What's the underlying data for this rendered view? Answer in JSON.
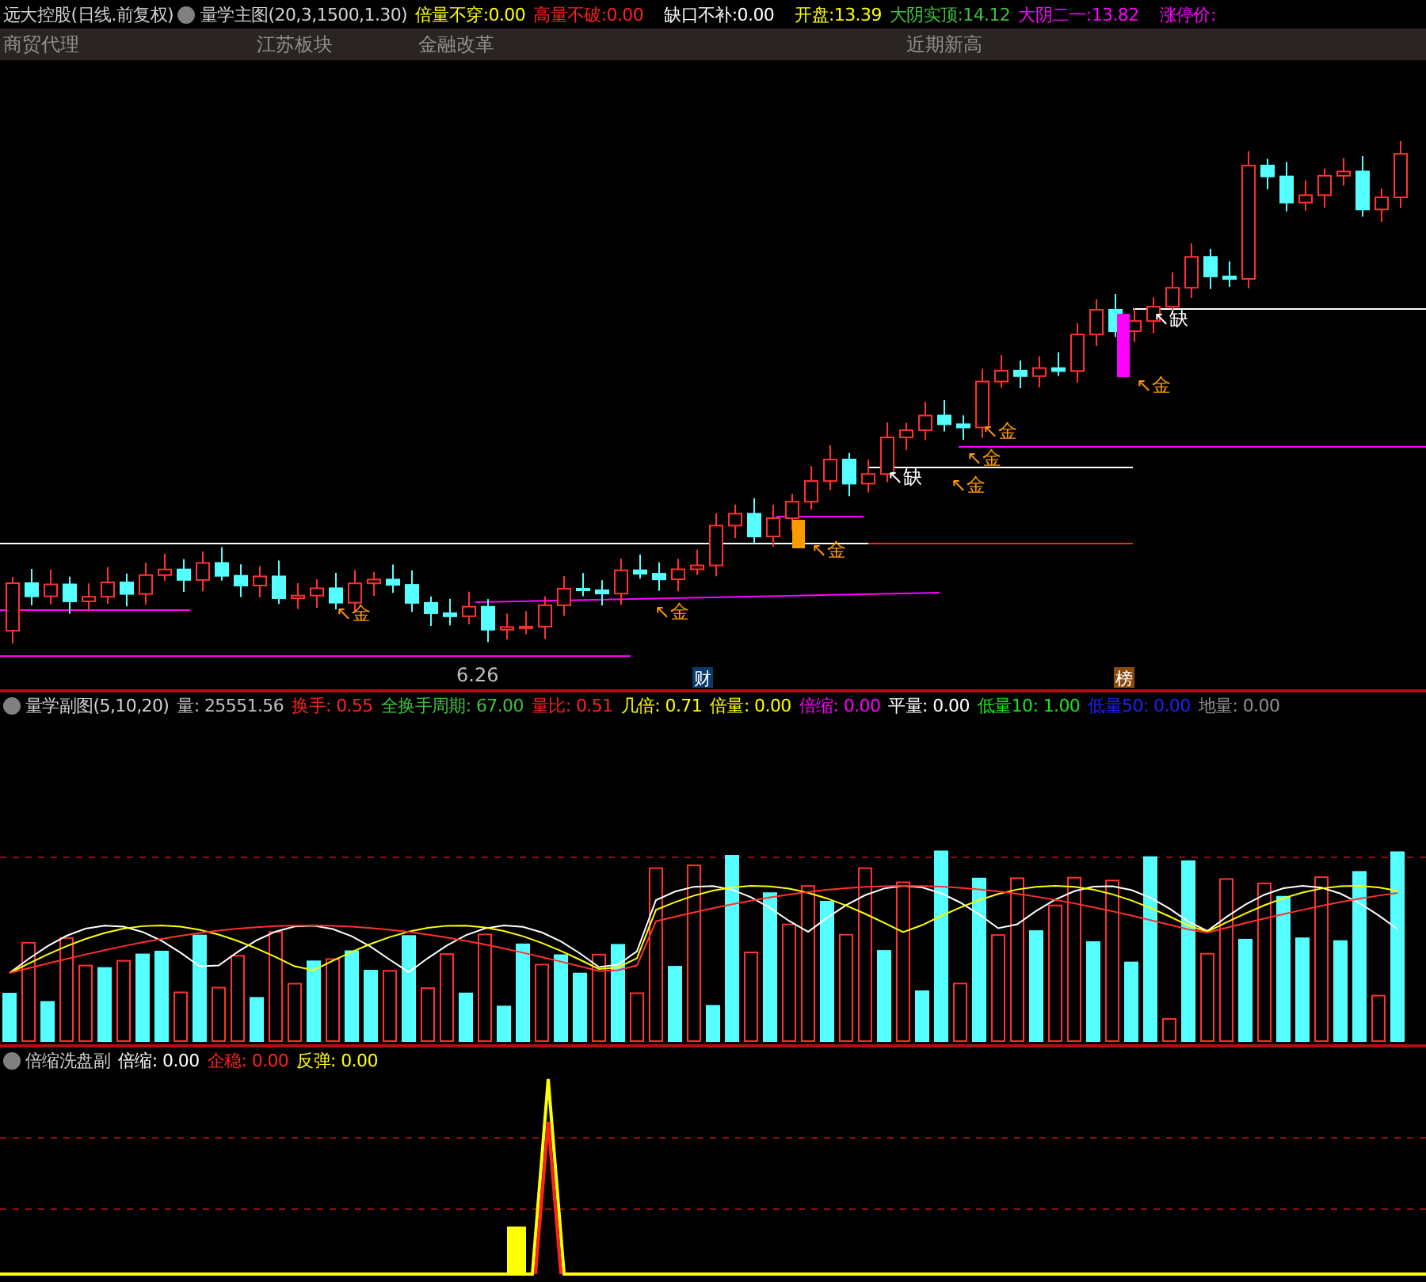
{
  "main_header": {
    "title": "远大控股(日线.前复权)",
    "indicator": "量学主图(20,3,1500,1.30)",
    "fields": [
      {
        "label": "倍量不穿:",
        "value": "0.00",
        "color": "#ffff00"
      },
      {
        "label": "高量不破:",
        "value": "0.00",
        "color": "#ff2020"
      },
      {
        "label": "缺口不补:",
        "value": "0.00",
        "color": "#ffffff"
      },
      {
        "label": "开盘:",
        "value": "13.39",
        "color": "#ffff00"
      },
      {
        "label": "大阴实顶:",
        "value": "14.12",
        "color": "#40c040"
      },
      {
        "label": "大阴二一:",
        "value": "13.82",
        "color": "#ff00ff"
      },
      {
        "label": "涨停价:",
        "color": "#ff00ff"
      }
    ]
  },
  "tags": [
    {
      "label": "商贸代理"
    },
    {
      "label": "江苏板块"
    },
    {
      "label": "金融改革"
    },
    {
      "label": "近期新高"
    }
  ],
  "markers": [
    {
      "text": "↖金",
      "kind": "gold"
    },
    {
      "text": "↖金",
      "kind": "gold"
    },
    {
      "text": "↖金",
      "kind": "gold"
    },
    {
      "text": "↖金",
      "kind": "gold"
    },
    {
      "text": "↖金",
      "kind": "gold"
    },
    {
      "text": "↖金",
      "kind": "gold"
    },
    {
      "text": "↖金",
      "kind": "gold"
    },
    {
      "text": "↖缺",
      "kind": "gap"
    },
    {
      "text": "↖缺",
      "kind": "gap"
    },
    {
      "text": "6.26",
      "kind": "price"
    },
    {
      "text": "财",
      "kind": "news"
    },
    {
      "text": "榜",
      "kind": "rank"
    }
  ],
  "volume_header": {
    "indicator": "量学副图(5,10,20)",
    "fields": [
      {
        "label": "量:",
        "value": "25551.56",
        "color": "#c0c0c0"
      },
      {
        "label": "换手:",
        "value": "0.55",
        "color": "#ff2020"
      },
      {
        "label": "全换手周期:",
        "value": "67.00",
        "color": "#40c040"
      },
      {
        "label": "量比:",
        "value": "0.51",
        "color": "#ff2020"
      },
      {
        "label": "几倍:",
        "value": "0.71",
        "color": "#ffff00"
      },
      {
        "label": "倍量:",
        "value": "0.00",
        "color": "#ffff00"
      },
      {
        "label": "倍缩:",
        "value": "0.00",
        "color": "#ff00ff"
      },
      {
        "label": "平量:",
        "value": "0.00",
        "color": "#ffffff"
      },
      {
        "label": "低量10:",
        "value": "1.00",
        "color": "#20e020"
      },
      {
        "label": "低量50:",
        "value": "0.00",
        "color": "#2020ff"
      },
      {
        "label": "地量:",
        "value": "0.00",
        "color": "#909090"
      }
    ]
  },
  "wash_header": {
    "indicator": "倍缩洗盘副",
    "fields": [
      {
        "label": "倍缩:",
        "value": "0.00",
        "color": "#ffffff"
      },
      {
        "label": "企稳:",
        "value": "0.00",
        "color": "#ff2020"
      },
      {
        "label": "反弹:",
        "value": "0.00",
        "color": "#ffff00"
      }
    ]
  }
}
